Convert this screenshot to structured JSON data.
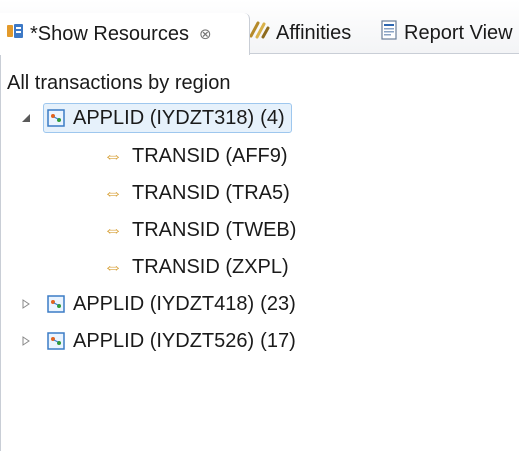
{
  "tabs": [
    {
      "label": "*Show Resources",
      "icon": "show-resources-icon",
      "active": true,
      "close_symbol": "⊗"
    },
    {
      "label": "Affinities",
      "icon": "affinities-icon",
      "active": false
    },
    {
      "label": "Report View",
      "icon": "report-view-icon",
      "active": false
    }
  ],
  "panel": {
    "title": "All transactions by region"
  },
  "tree": [
    {
      "label": "APPLID (IYDZT318)",
      "count": "(4)",
      "expanded": true,
      "selected": true,
      "children": [
        {
          "label": "TRANSID (AFF9)"
        },
        {
          "label": "TRANSID (TRA5)"
        },
        {
          "label": "TRANSID (TWEB)"
        },
        {
          "label": "TRANSID (ZXPL)"
        }
      ]
    },
    {
      "label": "APPLID (IYDZT418)",
      "count": "(23)",
      "expanded": false,
      "selected": false
    },
    {
      "label": "APPLID (IYDZT526)",
      "count": "(17)",
      "expanded": false,
      "selected": false
    }
  ],
  "colors": {
    "selection_bg": "#e6f1fb",
    "selection_border": "#9ec7ee",
    "transaction_icon": "#d8a23b"
  }
}
